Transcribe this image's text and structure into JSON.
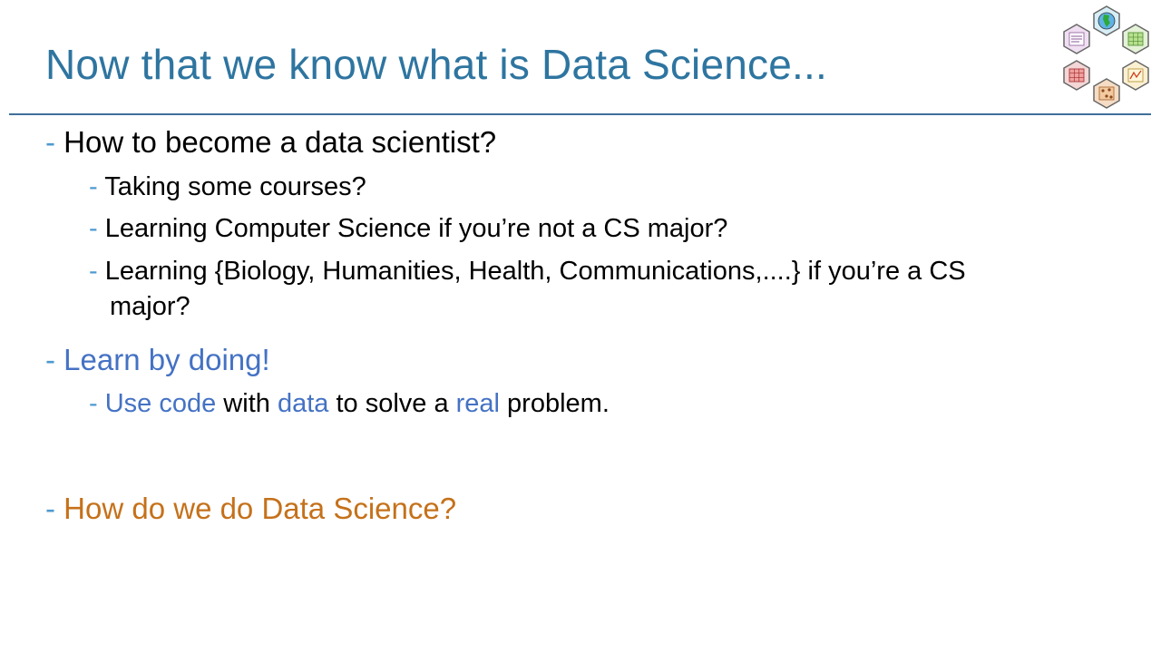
{
  "slide": {
    "title": "Now that we know what is Data Science...",
    "dash": "-",
    "bullets": {
      "b1": "How to become a data scientist?",
      "b1_sub1": "Taking some courses?",
      "b1_sub2": "Learning Computer Science if you’re not a CS major?",
      "b1_sub3_line1": "Learning {Biology, Humanities, Health, Communications,....} if you’re a CS",
      "b1_sub3_line2": "major?",
      "b2": "Learn by doing!",
      "b2_sub1": {
        "part1": "Use code",
        "part2": " with ",
        "part3": "data",
        "part4": " to solve a ",
        "part5": "real",
        "part6": " problem."
      },
      "b3": "How do we do Data Science?"
    }
  },
  "colors": {
    "title": "#2e75a0",
    "rule": "#3f6f9c",
    "dash": "#4e9ad0",
    "blue_text": "#4472c4",
    "orange_text": "#c5711a"
  },
  "logo": {
    "icon": "hexagon-data-science-logo"
  }
}
